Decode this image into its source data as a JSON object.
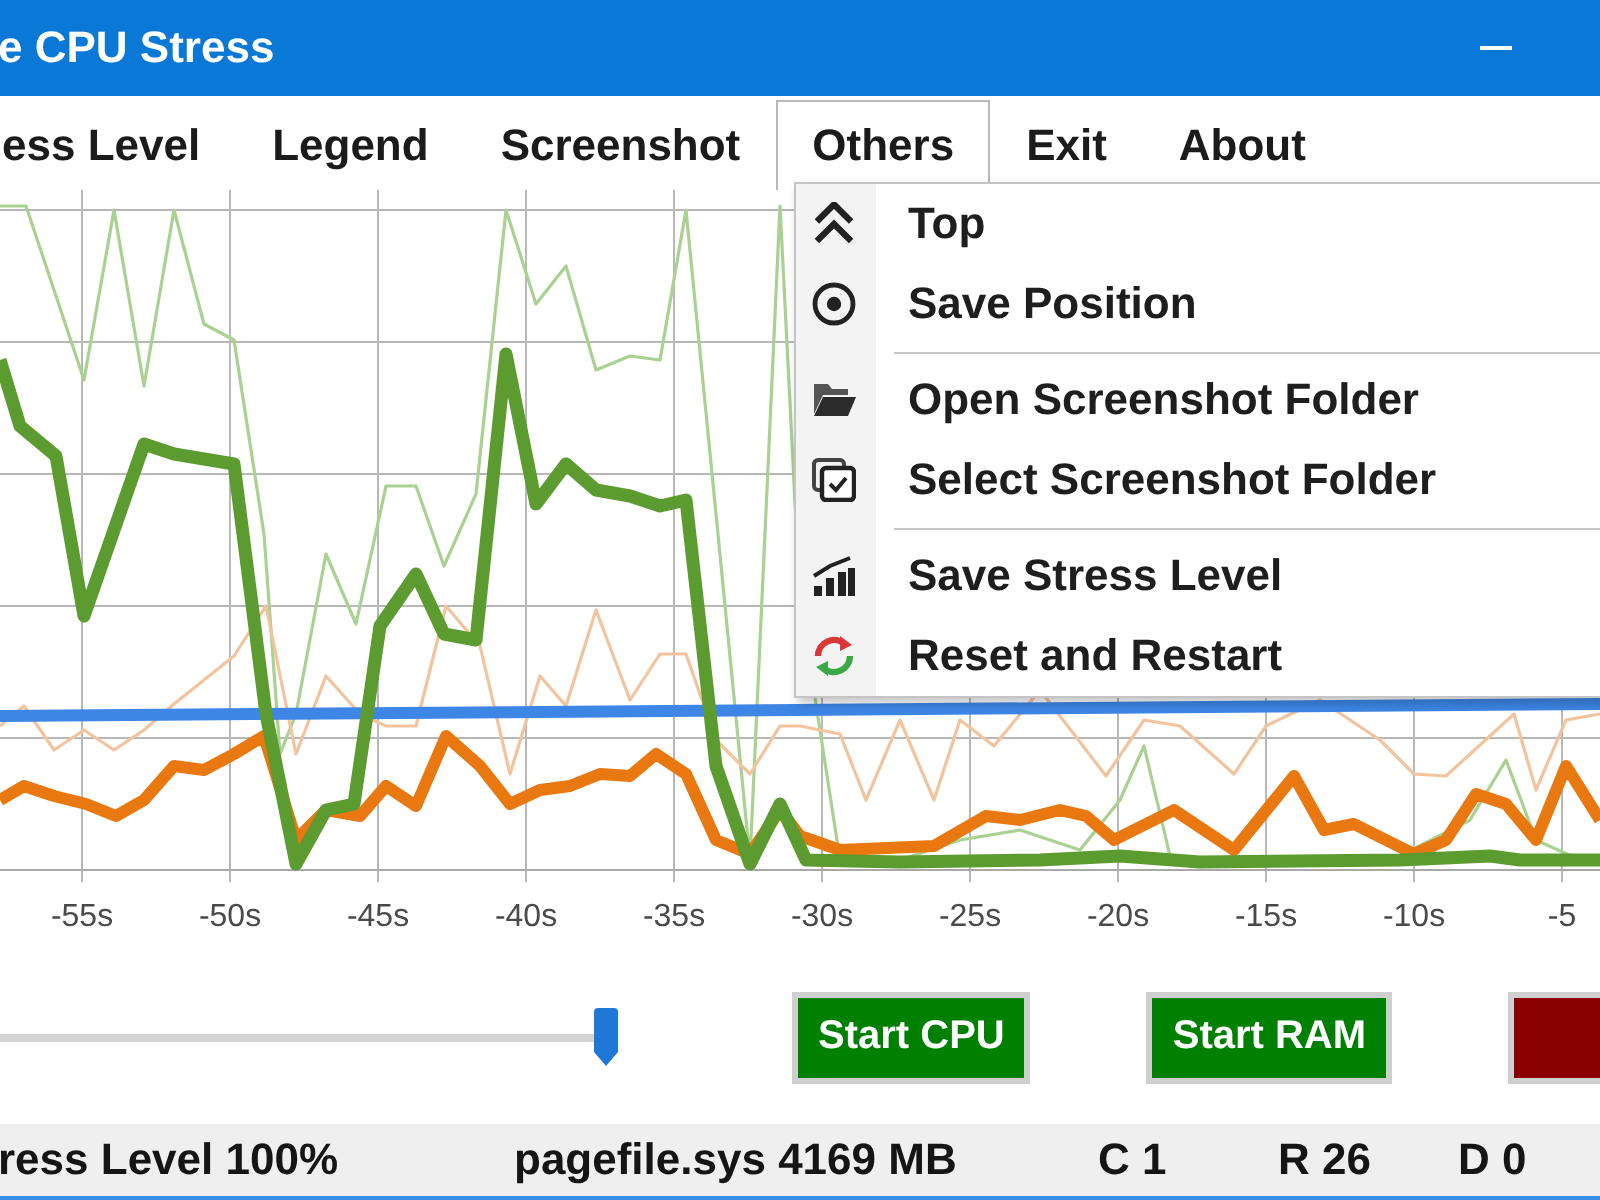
{
  "window": {
    "title": "e CPU Stress"
  },
  "menu": {
    "items": [
      {
        "label": "ess Level",
        "selected": false
      },
      {
        "label": "Legend",
        "selected": false
      },
      {
        "label": "Screenshot",
        "selected": false
      },
      {
        "label": "Others",
        "selected": true
      },
      {
        "label": "Exit",
        "selected": false
      },
      {
        "label": "About",
        "selected": false
      }
    ]
  },
  "dropdown": {
    "groups": [
      [
        {
          "label": "Top"
        },
        {
          "label": "Save Position"
        }
      ],
      [
        {
          "label": "Open Screenshot Folder"
        },
        {
          "label": "Select Screenshot Folder"
        }
      ],
      [
        {
          "label": "Save Stress Level"
        },
        {
          "label": "Reset and Restart"
        }
      ]
    ]
  },
  "chart": {
    "x_tick_labels": [
      "-55s",
      "-50s",
      "-45s",
      "-40s",
      "-35s",
      "-30s",
      "-25s",
      "-20s",
      "-15s",
      "-10s",
      "-5"
    ]
  },
  "slider": {
    "level": 1
  },
  "buttons": [
    {
      "label": "Start CPU",
      "color": "#008000"
    },
    {
      "label": "Start RAM",
      "color": "#008000"
    },
    {
      "color": "#8b0000"
    }
  ],
  "status_bar": [
    "ress Level 100%",
    "pagefile.sys 4169 MB",
    "C 1",
    "R 26",
    "D 0"
  ]
}
